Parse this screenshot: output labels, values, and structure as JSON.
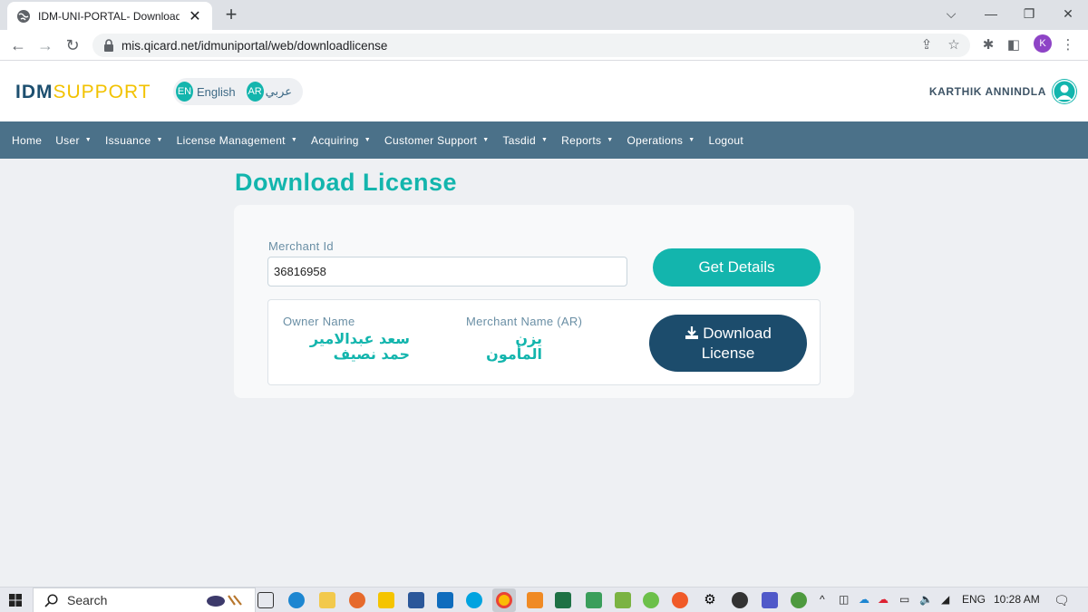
{
  "browser": {
    "tab_title": "IDM-UNI-PORTAL- Download Lic",
    "url": "mis.qicard.net/idmuniportal/web/downloadlicense",
    "profile_initial": "K"
  },
  "header": {
    "logo_idm": "IDM",
    "logo_support": "SUPPORT",
    "lang_en_code": "EN",
    "lang_en_name": "English",
    "lang_ar_code": "AR",
    "lang_ar_name": "عربي",
    "user_name": "KARTHIK ANNINDLA"
  },
  "menu": [
    {
      "label": "Home",
      "dropdown": false
    },
    {
      "label": "User",
      "dropdown": true
    },
    {
      "label": "Issuance",
      "dropdown": true
    },
    {
      "label": "License Management",
      "dropdown": true
    },
    {
      "label": "Acquiring",
      "dropdown": true
    },
    {
      "label": "Customer Support",
      "dropdown": true
    },
    {
      "label": "Tasdid",
      "dropdown": true
    },
    {
      "label": "Reports",
      "dropdown": true
    },
    {
      "label": "Operations",
      "dropdown": true
    },
    {
      "label": "Logout",
      "dropdown": false
    }
  ],
  "page": {
    "title": "Download License",
    "merchant_id_label": "Merchant Id",
    "merchant_id_value": "36816958",
    "get_details_label": "Get Details",
    "owner_name_label": "Owner Name",
    "owner_name_value": "سعد عبدالامير حمد نصيف",
    "merchant_name_label": "Merchant Name (AR)",
    "merchant_name_value": "يزن المأمون",
    "download_line1": "Download",
    "download_line2": "License"
  },
  "taskbar": {
    "search_label": "Search",
    "language": "ENG",
    "time": "10:28 AM"
  },
  "colors": {
    "teal": "#13b5ad",
    "navy": "#1c4c6c",
    "menubar": "#4b7189",
    "gold": "#f2c200"
  }
}
